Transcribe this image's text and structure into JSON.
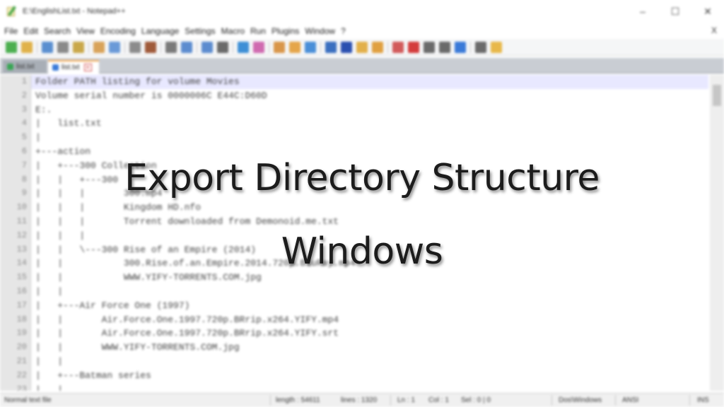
{
  "window": {
    "title": "E:\\EnglishList.txt - Notepad++",
    "controls": [
      "–",
      "☐",
      "✕"
    ]
  },
  "menu": {
    "items": [
      "File",
      "Edit",
      "Search",
      "View",
      "Encoding",
      "Language",
      "Settings",
      "Macro",
      "Run",
      "Plugins",
      "Window",
      "?"
    ],
    "close_label": "X"
  },
  "toolbar": {
    "button_colors": [
      "#4caf50",
      "#e0b24a",
      "#5a8fd0",
      "#8a8a8a",
      "#c9a84a",
      "#d9a35a",
      "#6a9ad8",
      "#8c8c8c",
      "#a05a3a",
      "#7a7a7a",
      "#5c8ccf",
      "#5c8ccf",
      "#6a6a6a",
      "#3d8fd6",
      "#d06ab0",
      "#d9964a",
      "#e5a64a",
      "#4a8fd8",
      "#3a6fc0",
      "#2a4fb0",
      "#e2b04a",
      "#e0a040",
      "#d25a5a",
      "#d43c3c",
      "#6a6a6a",
      "#6a6a6a",
      "#3a7ad8",
      "#6a6a6a",
      "#e8b84a"
    ]
  },
  "tabs": [
    {
      "label": "list.txt",
      "active": false,
      "dot_color": "#3aa655"
    },
    {
      "label": "list.txt",
      "active": true,
      "dot_color": "#3a7ad8"
    }
  ],
  "editor": {
    "lines": [
      {
        "n": "1",
        "text": "Folder PATH listing for volume Movies"
      },
      {
        "n": "2",
        "text": "Volume serial number is 0000006C E44C:D60D"
      },
      {
        "n": "3",
        "text": "E:."
      },
      {
        "n": "4",
        "text": "|   list.txt"
      },
      {
        "n": "5",
        "text": "|"
      },
      {
        "n": "6",
        "text": "+---action"
      },
      {
        "n": "7",
        "text": "|   +---300 Collection"
      },
      {
        "n": "8",
        "text": "|   |   +---300"
      },
      {
        "n": "9",
        "text": "|   |   |       300.mp4"
      },
      {
        "n": "10",
        "text": "|   |   |       Kingdom HD.nfo"
      },
      {
        "n": "11",
        "text": "|   |   |       Torrent downloaded from Demonoid.me.txt"
      },
      {
        "n": "12",
        "text": "|   |   |"
      },
      {
        "n": "13",
        "text": "|   |   \\---300 Rise of an Empire (2014)"
      },
      {
        "n": "14",
        "text": "|   |           300.Rise.of.an.Empire.2014.720p.BluRay.mp4"
      },
      {
        "n": "15",
        "text": "|   |           WWW.YIFY-TORRENTS.COM.jpg"
      },
      {
        "n": "16",
        "text": "|   |"
      },
      {
        "n": "17",
        "text": "|   +---Air Force One (1997)"
      },
      {
        "n": "18",
        "text": "|   |       Air.Force.One.1997.720p.BRrip.x264.YIFY.mp4"
      },
      {
        "n": "19",
        "text": "|   |       Air.Force.One.1997.720p.BRrip.x264.YIFY.srt"
      },
      {
        "n": "20",
        "text": "|   |       WWW.YIFY-TORRENTS.COM.jpg"
      },
      {
        "n": "21",
        "text": "|   |"
      },
      {
        "n": "22",
        "text": "|   +---Batman series"
      },
      {
        "n": "23",
        "text": "|   |"
      }
    ]
  },
  "statusbar": {
    "file_type": "Normal text file",
    "length": "length : 54611",
    "lines": "lines : 1320",
    "ln": "Ln : 1",
    "col": "Col : 1",
    "sel": "Sel : 0 | 0",
    "eol": "Dos\\Windows",
    "encoding": "ANSI",
    "mode": "INS"
  },
  "overlay": {
    "line1": "Export Directory Structure",
    "line2": "Windows"
  }
}
